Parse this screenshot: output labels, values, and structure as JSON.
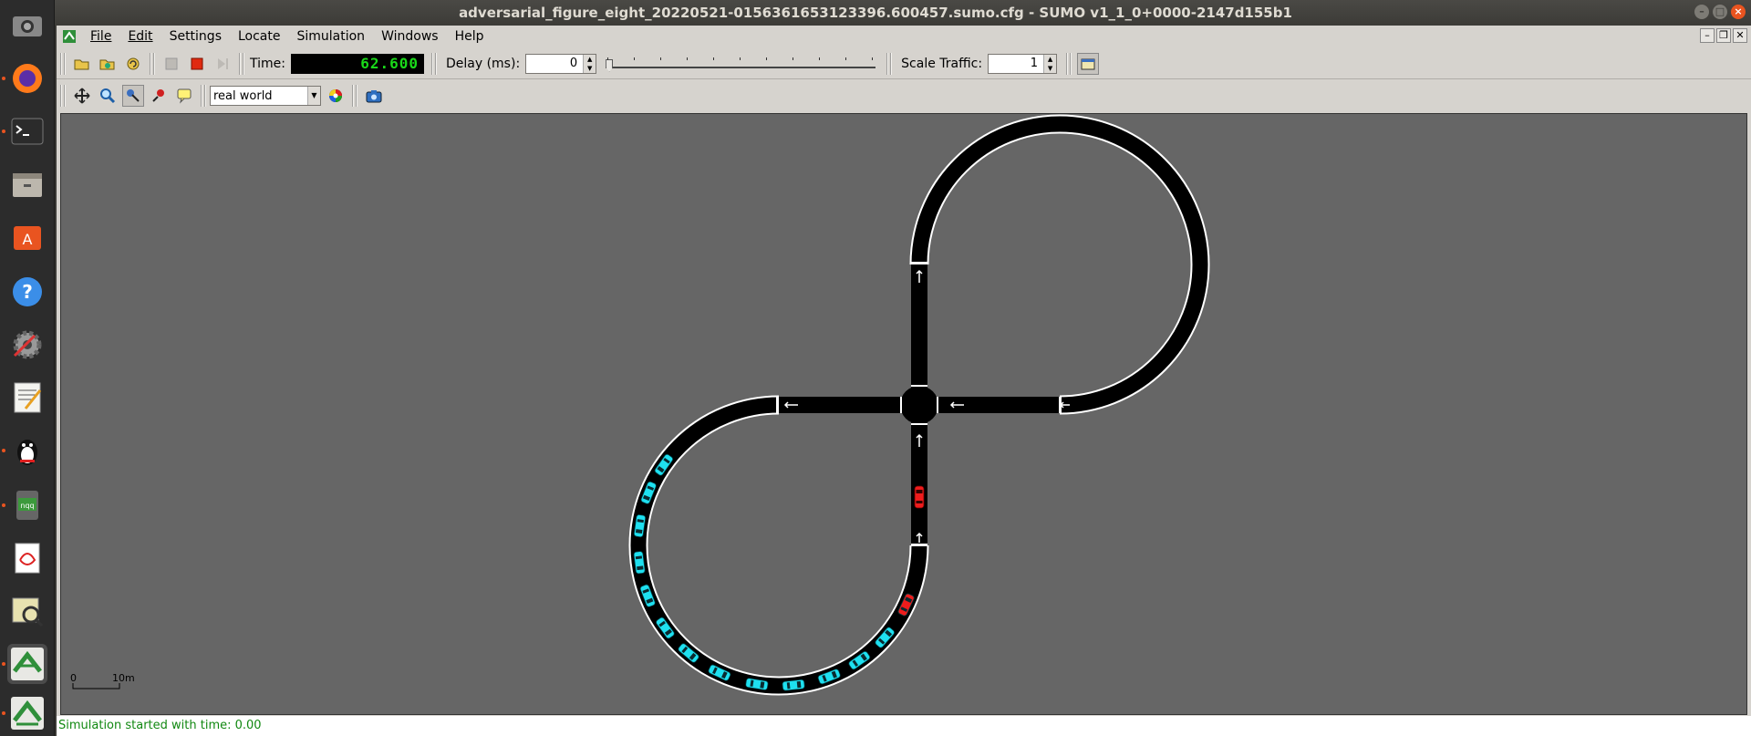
{
  "window": {
    "title": "adversarial_figure_eight_20220521-0156361653123396.600457.sumo.cfg - SUMO v1_1_0+0000-2147d155b1"
  },
  "dock": {
    "items": [
      {
        "name": "screenshot-app-icon",
        "active": false,
        "dot": false
      },
      {
        "name": "firefox-icon",
        "active": false,
        "dot": true
      },
      {
        "name": "terminal-icon",
        "active": false,
        "dot": true
      },
      {
        "name": "files-icon",
        "active": false,
        "dot": false
      },
      {
        "name": "software-center-icon",
        "active": false,
        "dot": false
      },
      {
        "name": "help-icon",
        "active": false,
        "dot": false
      },
      {
        "name": "system-settings-icon",
        "active": false,
        "dot": false
      },
      {
        "name": "text-editor-icon",
        "active": false,
        "dot": false
      },
      {
        "name": "qq-penguin-icon",
        "active": false,
        "dot": true
      },
      {
        "name": "nqq-icon",
        "active": false,
        "dot": true
      },
      {
        "name": "document-viewer-icon",
        "active": false,
        "dot": false
      },
      {
        "name": "map-viewer-icon",
        "active": false,
        "dot": false
      },
      {
        "name": "sumo-gui-icon",
        "active": true,
        "dot": true
      },
      {
        "name": "sumo-netedit-icon",
        "active": false,
        "dot": true
      }
    ]
  },
  "menu": {
    "file": "File",
    "edit": "Edit",
    "settings": "Settings",
    "locate": "Locate",
    "simulation": "Simulation",
    "windows": "Windows",
    "help": "Help"
  },
  "toolbar": {
    "time_label": "Time:",
    "time_value": "62.600",
    "delay_label": "Delay (ms):",
    "delay_value": "0",
    "scale_label": "Scale Traffic:",
    "scale_value": "1",
    "delay_slider_level": 0
  },
  "viewbar": {
    "scheme": "real world"
  },
  "scale": {
    "zero": "0",
    "length": "10m"
  },
  "status": {
    "message": "Simulation started with time: 0.00"
  },
  "vehicles": [
    {
      "angle": 145,
      "color": "cyan"
    },
    {
      "angle": 158,
      "color": "cyan"
    },
    {
      "angle": 172,
      "color": "cyan"
    },
    {
      "angle": 187,
      "color": "cyan"
    },
    {
      "angle": 201,
      "color": "cyan"
    },
    {
      "angle": 216,
      "color": "cyan"
    },
    {
      "angle": 230,
      "color": "cyan"
    },
    {
      "angle": 245,
      "color": "cyan"
    },
    {
      "angle": 261,
      "color": "cyan"
    },
    {
      "angle": 276,
      "color": "cyan"
    },
    {
      "angle": 291,
      "color": "cyan"
    },
    {
      "angle": 305,
      "color": "cyan"
    },
    {
      "angle": 319,
      "color": "cyan"
    },
    {
      "angle": 335,
      "color": "red"
    }
  ],
  "colors": {
    "vehicle_cyan": "#1ee0f0",
    "vehicle_red": "#ee1c1c",
    "background": "#666666",
    "road": "#000000"
  }
}
